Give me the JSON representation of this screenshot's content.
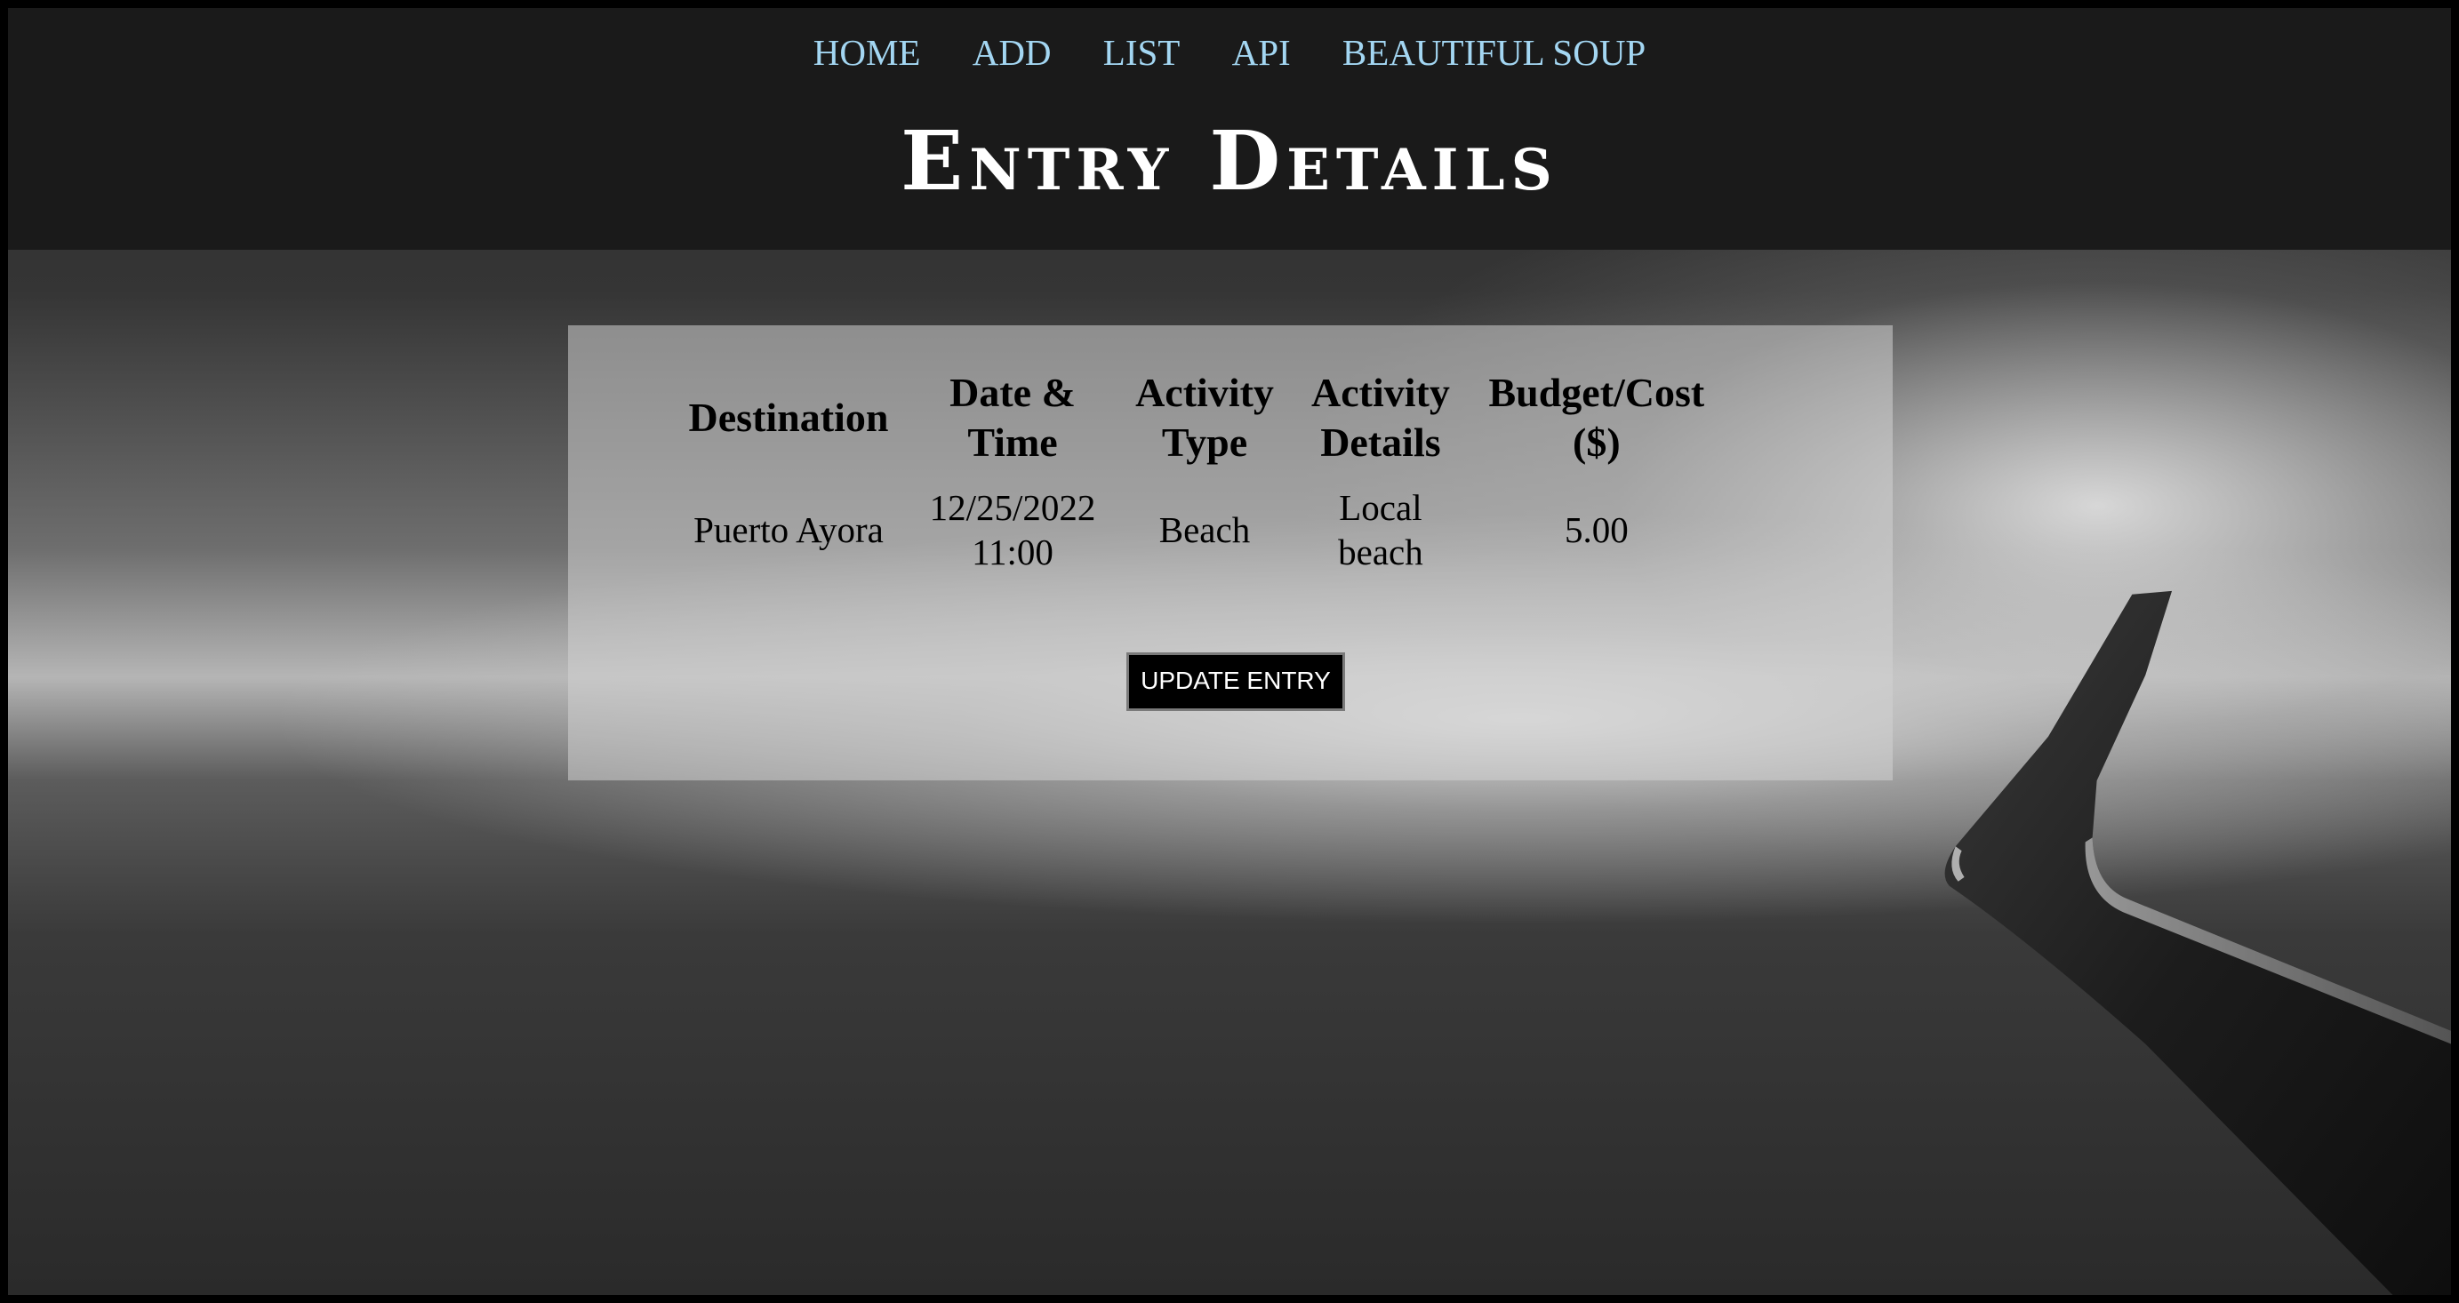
{
  "nav": {
    "items": [
      {
        "label": "HOME"
      },
      {
        "label": "ADD"
      },
      {
        "label": "LIST"
      },
      {
        "label": "API"
      },
      {
        "label": "BEAUTIFUL SOUP"
      }
    ]
  },
  "page": {
    "title": "Entry Details"
  },
  "entry_table": {
    "headers": {
      "destination": "Destination",
      "date_time_line1": "Date &",
      "date_time_line2": "Time",
      "activity_type_line1": "Activity",
      "activity_type_line2": "Type",
      "activity_details_line1": "Activity",
      "activity_details_line2": "Details",
      "budget_line1": "Budget/Cost",
      "budget_line2": "($)"
    },
    "row": {
      "destination": "Puerto Ayora",
      "date": "12/25/2022",
      "time": "11:00",
      "activity_type": "Beach",
      "activity_details_line1": "Local",
      "activity_details_line2": "beach",
      "budget": "5.00"
    }
  },
  "actions": {
    "update_label": "UPDATE ENTRY"
  },
  "colors": {
    "nav_link": "#a3d6f2",
    "header_bg": "#1a1a1a",
    "title": "#ffffff",
    "button_bg": "#000000"
  }
}
